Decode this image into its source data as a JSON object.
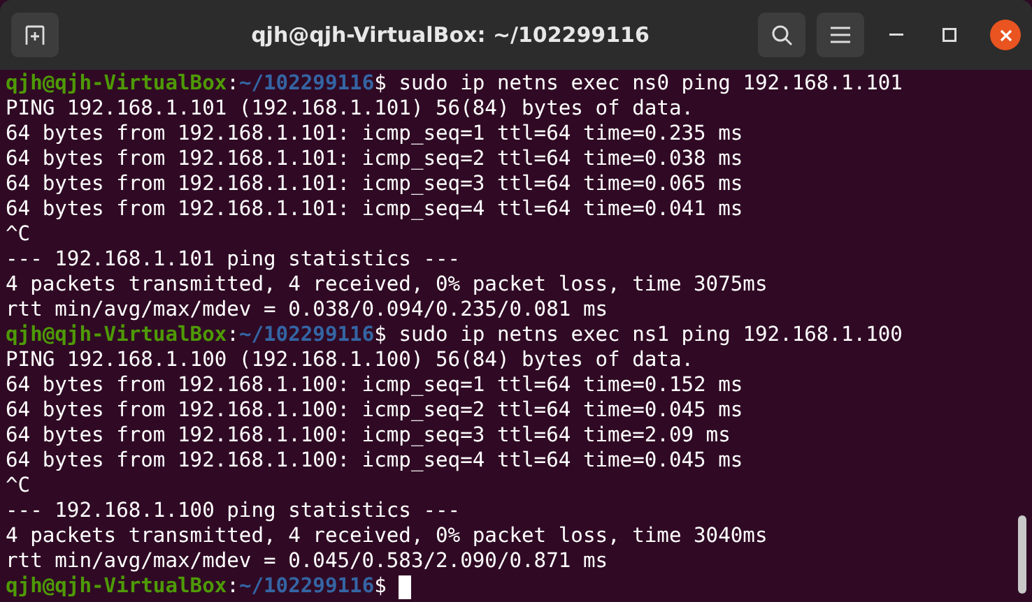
{
  "window": {
    "title": "qjh@qjh-VirtualBox: ~/102299116"
  },
  "terminal": {
    "lines": [
      {
        "kind": "prompt",
        "host": "qjh@qjh-VirtualBox",
        "separator": ":",
        "path": "~/102299116",
        "symbol": "$",
        "command": " sudo ip netns exec ns0 ping 192.168.1.101",
        "cursor": false
      },
      {
        "kind": "output",
        "text": "PING 192.168.1.101 (192.168.1.101) 56(84) bytes of data."
      },
      {
        "kind": "output",
        "text": "64 bytes from 192.168.1.101: icmp_seq=1 ttl=64 time=0.235 ms"
      },
      {
        "kind": "output",
        "text": "64 bytes from 192.168.1.101: icmp_seq=2 ttl=64 time=0.038 ms"
      },
      {
        "kind": "output",
        "text": "64 bytes from 192.168.1.101: icmp_seq=3 ttl=64 time=0.065 ms"
      },
      {
        "kind": "output",
        "text": "64 bytes from 192.168.1.101: icmp_seq=4 ttl=64 time=0.041 ms"
      },
      {
        "kind": "output",
        "text": "^C"
      },
      {
        "kind": "output",
        "text": "--- 192.168.1.101 ping statistics ---"
      },
      {
        "kind": "output",
        "text": "4 packets transmitted, 4 received, 0% packet loss, time 3075ms"
      },
      {
        "kind": "output",
        "text": "rtt min/avg/max/mdev = 0.038/0.094/0.235/0.081 ms"
      },
      {
        "kind": "prompt",
        "host": "qjh@qjh-VirtualBox",
        "separator": ":",
        "path": "~/102299116",
        "symbol": "$",
        "command": " sudo ip netns exec ns1 ping 192.168.1.100",
        "cursor": false
      },
      {
        "kind": "output",
        "text": "PING 192.168.1.100 (192.168.1.100) 56(84) bytes of data."
      },
      {
        "kind": "output",
        "text": "64 bytes from 192.168.1.100: icmp_seq=1 ttl=64 time=0.152 ms"
      },
      {
        "kind": "output",
        "text": "64 bytes from 192.168.1.100: icmp_seq=2 ttl=64 time=0.045 ms"
      },
      {
        "kind": "output",
        "text": "64 bytes from 192.168.1.100: icmp_seq=3 ttl=64 time=2.09 ms"
      },
      {
        "kind": "output",
        "text": "64 bytes from 192.168.1.100: icmp_seq=4 ttl=64 time=0.045 ms"
      },
      {
        "kind": "output",
        "text": "^C"
      },
      {
        "kind": "output",
        "text": "--- 192.168.1.100 ping statistics ---"
      },
      {
        "kind": "output",
        "text": "4 packets transmitted, 4 received, 0% packet loss, time 3040ms"
      },
      {
        "kind": "output",
        "text": "rtt min/avg/max/mdev = 0.045/0.583/2.090/0.871 ms"
      },
      {
        "kind": "prompt",
        "host": "qjh@qjh-VirtualBox",
        "separator": ":",
        "path": "~/102299116",
        "symbol": "$",
        "cursor": true
      }
    ]
  }
}
